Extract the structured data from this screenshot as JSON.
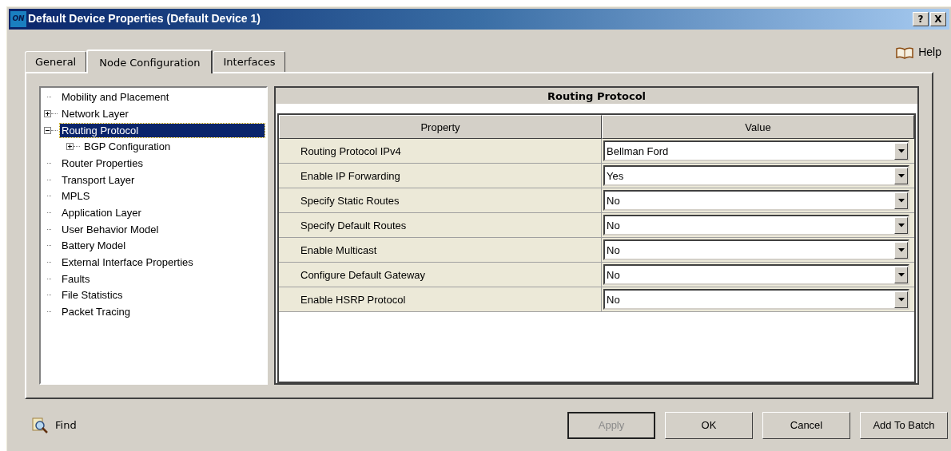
{
  "window": {
    "title": "Default Device Properties (Default Device 1)",
    "app_badge": "ON",
    "title_buttons": [
      "?",
      "X"
    ]
  },
  "tabs": [
    {
      "label": "General",
      "selected": false
    },
    {
      "label": "Node Configuration",
      "selected": true
    },
    {
      "label": "Interfaces",
      "selected": false
    }
  ],
  "help": {
    "label": "Help"
  },
  "tree": [
    {
      "label": "Mobility and Placement",
      "kind": "leaf",
      "selected": false
    },
    {
      "label": "Network Layer",
      "kind": "branch",
      "expanded": false,
      "selected": false
    },
    {
      "label": "Routing Protocol",
      "kind": "branch",
      "expanded": true,
      "selected": true,
      "children": [
        {
          "label": "BGP Configuration",
          "kind": "branch",
          "expanded": false,
          "selected": false
        }
      ]
    },
    {
      "label": "Router Properties",
      "kind": "leaf",
      "selected": false
    },
    {
      "label": "Transport Layer",
      "kind": "leaf",
      "selected": false
    },
    {
      "label": "MPLS",
      "kind": "leaf",
      "selected": false
    },
    {
      "label": "Application Layer",
      "kind": "leaf",
      "selected": false
    },
    {
      "label": "User Behavior Model",
      "kind": "leaf",
      "selected": false
    },
    {
      "label": "Battery Model",
      "kind": "leaf",
      "selected": false
    },
    {
      "label": "External Interface Properties",
      "kind": "leaf",
      "selected": false
    },
    {
      "label": "Faults",
      "kind": "leaf",
      "selected": false
    },
    {
      "label": "File Statistics",
      "kind": "leaf",
      "selected": false
    },
    {
      "label": "Packet Tracing",
      "kind": "leaf",
      "selected": false
    }
  ],
  "table": {
    "title": "Routing Protocol",
    "columns": [
      "Property",
      "Value"
    ],
    "rows": [
      {
        "property": "Routing Protocol IPv4",
        "value": "Bellman Ford"
      },
      {
        "property": "Enable IP Forwarding",
        "value": "Yes"
      },
      {
        "property": "Specify Static Routes",
        "value": "No"
      },
      {
        "property": "Specify Default Routes",
        "value": "No"
      },
      {
        "property": "Enable Multicast",
        "value": "No"
      },
      {
        "property": "Configure Default Gateway",
        "value": "No"
      },
      {
        "property": "Enable HSRP Protocol",
        "value": "No"
      }
    ]
  },
  "find": {
    "label": "Find"
  },
  "buttons": [
    {
      "label": "Apply",
      "disabled": true
    },
    {
      "label": "OK",
      "disabled": false
    },
    {
      "label": "Cancel",
      "disabled": false
    },
    {
      "label": "Add To Batch",
      "disabled": false
    }
  ]
}
